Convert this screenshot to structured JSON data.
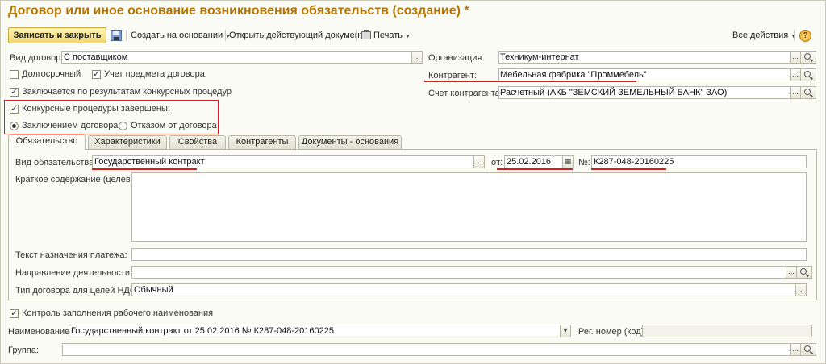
{
  "window": {
    "title": "Договор или иное основание возникновения обязательств (создание) *"
  },
  "toolbar": {
    "save_close": "Записать и закрыть",
    "create_based": "Создать на основании",
    "open_current": "Открыть действующий документ",
    "print": "Печать",
    "all_actions": "Все действия"
  },
  "form": {
    "contract_type": {
      "label": "Вид договора:",
      "value": "С поставщиком"
    },
    "long_term": {
      "label": "Долгосрочный",
      "checked": false
    },
    "subject_accounting": {
      "label": "Учет предмета договора",
      "checked": true
    },
    "competitive": {
      "label": "Заключается по результатам конкурсных процедур",
      "checked": true
    },
    "procedures_done": {
      "label": "Конкурсные процедуры завершены:",
      "checked": true
    },
    "radio_conclusion": {
      "label": "Заключением договора",
      "selected": true
    },
    "radio_refusal": {
      "label": "Отказом от договора",
      "selected": false
    },
    "organization": {
      "label": "Организация:",
      "value": "Техникум-интернат"
    },
    "counterparty": {
      "label": "Контрагент:",
      "value": "Мебельная фабрика \"Проммебель\""
    },
    "counterparty_account": {
      "label": "Счет контрагента:",
      "value": "Расчетный (АКБ \"ЗЕМСКИЙ ЗЕМЕЛЬНЫЙ БАНК\" ЗАО)"
    }
  },
  "tabs": [
    {
      "label": "Обязательство",
      "active": true
    },
    {
      "label": "Характеристики",
      "active": false
    },
    {
      "label": "Свойства",
      "active": false
    },
    {
      "label": "Контрагенты",
      "active": false
    },
    {
      "label": "Документы - основания",
      "active": false
    }
  ],
  "obligation": {
    "type_label": "Вид обязательства:",
    "type_value": "Государственный контракт",
    "from_label": "от:",
    "date_value": "25.02.2016",
    "number_label": "№:",
    "number_value": "К287-048-20160225",
    "summary_label": "Краткое содержание (целево...",
    "payment_purpose_label": "Текст назначения платежа:",
    "activity_label": "Направление деятельности:",
    "vat_type_label": "Тип договора для целей НДС:",
    "vat_type_value": "Обычный"
  },
  "bottom": {
    "name_control": {
      "label": "Контроль заполнения рабочего наименования",
      "checked": true
    },
    "name_label": "Наименование:",
    "name_value": "Государственный контракт от 25.02.2016 № К287-048-20160225",
    "reg_label": "Рег. номер (код):",
    "reg_value": "",
    "group_label": "Группа:",
    "group_value": ""
  },
  "colors": {
    "title": "#b87400",
    "highlight": "#d02020",
    "button": "#efd76e"
  }
}
